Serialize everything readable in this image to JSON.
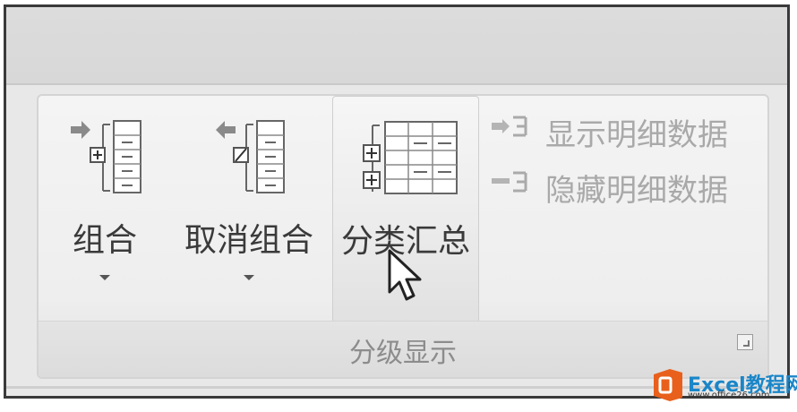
{
  "ribbon": {
    "group_title": "分级显示",
    "buttons": [
      {
        "label": "组合",
        "icon": "group-outline-icon",
        "has_dropdown": true
      },
      {
        "label": "取消组合",
        "icon": "ungroup-outline-icon",
        "has_dropdown": true
      },
      {
        "label": "分类汇总",
        "icon": "subtotal-icon",
        "has_dropdown": false,
        "state": "hover"
      }
    ],
    "small_buttons": [
      {
        "label": "显示明细数据",
        "icon": "show-detail-icon",
        "enabled": false
      },
      {
        "label": "隐藏明细数据",
        "icon": "hide-detail-icon",
        "enabled": false
      }
    ],
    "dialog_launcher_icon": "dialog-launcher-icon"
  },
  "watermark": {
    "main_text": "Excel教程网",
    "sub_text": "www.office26.com",
    "icon": "office-logo-icon"
  },
  "colors": {
    "ribbon_bg": "#eeeeee",
    "label_text": "#3a3a3a",
    "disabled_text": "#a9a9a9",
    "group_title": "#8c8c8c",
    "watermark_blue": "#1a86c8",
    "logo_orange": "#e8601c"
  }
}
